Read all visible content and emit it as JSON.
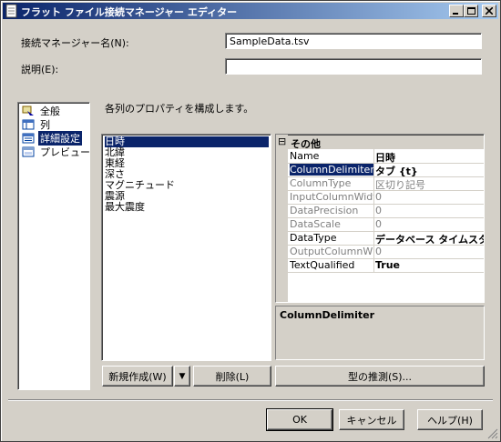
{
  "window": {
    "title": "フラット ファイル接続マネージャー エディター",
    "controls": {
      "minimize": "minimize-icon",
      "maximize": "maximize-icon",
      "close": "close-icon"
    }
  },
  "form": {
    "name_label": "接続マネージャー名(N):",
    "name_value": "SampleData.tsv",
    "description_label": "説明(E):",
    "description_value": ""
  },
  "nav": {
    "items": [
      {
        "label": "全般",
        "icon": "general-icon"
      },
      {
        "label": "列",
        "icon": "columns-icon"
      },
      {
        "label": "詳細設定",
        "icon": "advanced-icon",
        "selected": true
      },
      {
        "label": "プレビュー",
        "icon": "preview-icon"
      }
    ]
  },
  "main": {
    "instruction": "各列のプロパティを構成します。",
    "columns": [
      "日時",
      "北緯",
      "東経",
      "深さ",
      "マグニチュード",
      "震源",
      "最大震度"
    ]
  },
  "properties": {
    "category": "その他",
    "category_toggle": "⊟",
    "rows": [
      {
        "name": "Name",
        "value": "日時",
        "bold": true
      },
      {
        "name": "ColumnDelimiter",
        "value": "タブ {t}",
        "bold": true,
        "selected": true
      },
      {
        "name": "ColumnType",
        "value": "区切り記号",
        "disabled": true
      },
      {
        "name": "InputColumnWidth",
        "value": "0",
        "disabled": true
      },
      {
        "name": "DataPrecision",
        "value": "0",
        "disabled": true
      },
      {
        "name": "DataScale",
        "value": "0",
        "disabled": true
      },
      {
        "name": "DataType",
        "value": "データベース タイムスタン",
        "bold": true
      },
      {
        "name": "OutputColumnWidth",
        "value": "0",
        "disabled": true
      },
      {
        "name": "TextQualified",
        "value": "True",
        "bold": true
      }
    ],
    "description_title": "ColumnDelimiter"
  },
  "buttons": {
    "new": "新規作成(W)",
    "new_dropdown": "▼",
    "delete": "削除(L)",
    "suggest": "型の推測(S)...",
    "ok": "OK",
    "cancel": "キャンセル",
    "help": "ヘルプ(H)"
  },
  "colors": {
    "selection": "#0a246a",
    "face": "#d4d0c8",
    "title_start": "#0a246a",
    "title_end": "#a6caf0"
  }
}
